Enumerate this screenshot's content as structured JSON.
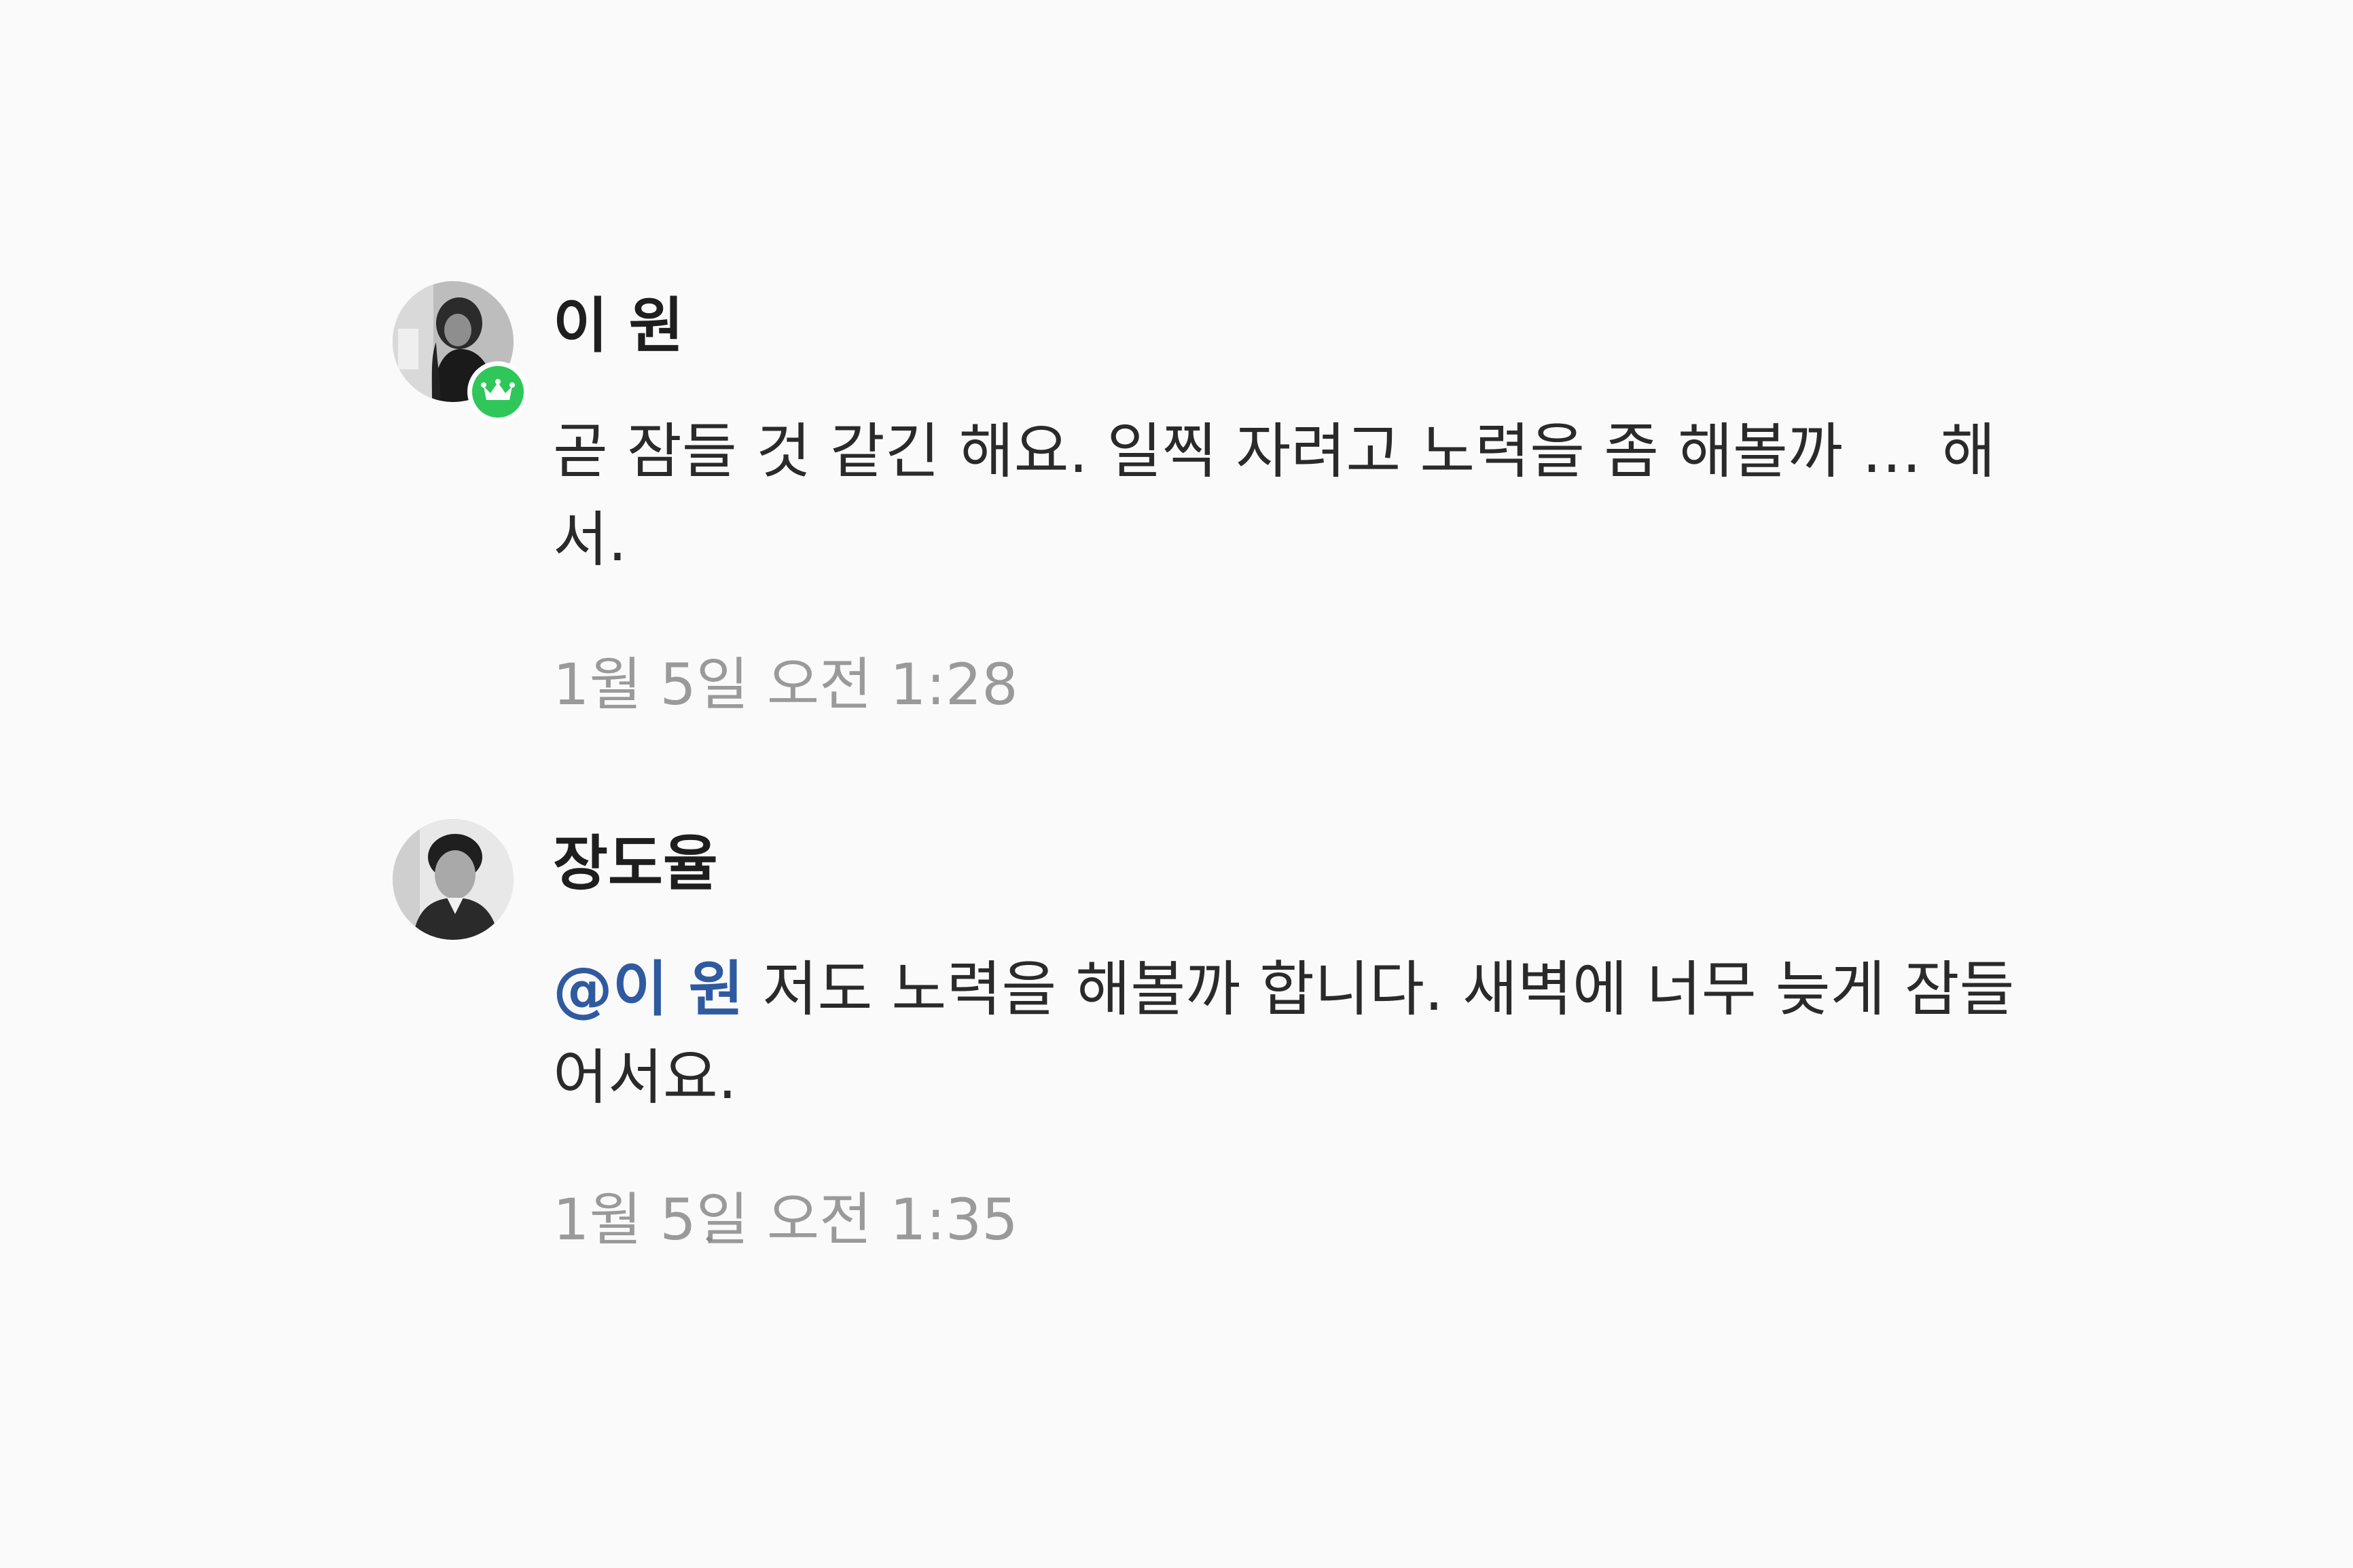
{
  "comments": [
    {
      "author": "이 원",
      "text": "곧 잠들 것 같긴 해요. 일찍 자려고 노력을 좀 해볼까 … 해서.",
      "timestamp": "1월 5일 오전 1:28",
      "badge_icon": "crown-icon",
      "badge_color": "#2fc75a"
    },
    {
      "author": "장도율",
      "mention": "@이 원",
      "text": " 저도 노력을 해볼까 합니다. 새벽에 너무 늦게 잠들어서요.",
      "timestamp": "1월 5일 오전 1:35"
    }
  ],
  "colors": {
    "background": "#fafafa",
    "mention": "#2f5aa0",
    "timestamp": "#9a9a9a",
    "author": "#1e1e1e"
  }
}
